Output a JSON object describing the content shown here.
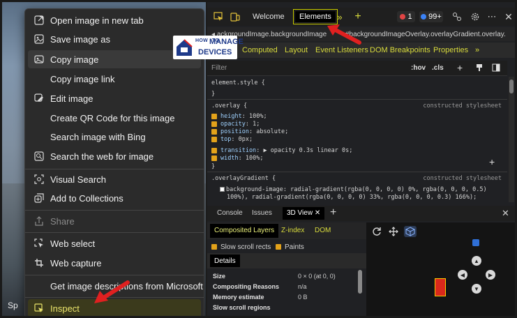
{
  "context_menu": {
    "items": [
      {
        "label": "Open image in new tab",
        "icon": "open-in-new-tab-icon"
      },
      {
        "label": "Save image as",
        "icon": "save-image-icon"
      },
      {
        "label": "Copy image",
        "icon": "copy-image-icon",
        "highlighted": true
      },
      {
        "label": "Copy image link",
        "icon": ""
      },
      {
        "label": "Edit image",
        "icon": "edit-image-icon"
      },
      {
        "label": "Create QR Code for this image",
        "icon": ""
      },
      {
        "label": "Search image with Bing",
        "icon": ""
      },
      {
        "label": "Search the web for image",
        "icon": "search-web-icon"
      },
      {
        "label": "Visual Search",
        "icon": "visual-search-icon"
      },
      {
        "label": "Add to Collections",
        "icon": "collections-icon"
      },
      {
        "label": "Share",
        "icon": "share-icon",
        "disabled": true
      },
      {
        "label": "Web select",
        "icon": "web-select-icon"
      },
      {
        "label": "Web capture",
        "icon": "web-capture-icon"
      },
      {
        "label": "Get image descriptions from Microsoft",
        "icon": ""
      },
      {
        "label": "Inspect",
        "icon": "inspect-icon"
      }
    ]
  },
  "taskbar_fragment": "Sp",
  "devtools": {
    "tabs": {
      "welcome": "Welcome",
      "elements": "Elements"
    },
    "badges": {
      "errors": "1",
      "info": "99+"
    },
    "breadcrumb": {
      "left": "ackgroundImage.backgroundImage",
      "right": "#backgroundImageOverlay.overlayGradient.overlay."
    },
    "subtabs": [
      "Computed",
      "Layout",
      "Event Listeners",
      "DOM Breakpoints",
      "Properties"
    ],
    "filter": {
      "placeholder": "Filter",
      "hov": ":hov",
      "cls": ".cls"
    },
    "styles": {
      "element_style": "element.style {",
      "close": "}",
      "overlay_selector": ".overlay {",
      "constructed": "constructed stylesheet",
      "overlay_props": [
        {
          "name": "height",
          "value": "100%;"
        },
        {
          "name": "opacity",
          "value": "1;"
        },
        {
          "name": "position",
          "value": "absolute;"
        },
        {
          "name": "top",
          "value": "0px;"
        },
        {
          "name": "transition",
          "value": "opacity 0.3s  linear 0s;"
        },
        {
          "name": "width",
          "value": "100%;"
        }
      ],
      "gradient_selector": ".overlayGradient {",
      "gradient_line1": "background-image: radial-gradient(rgba(0, 0, 0, 0) 0%, rgba(0, 0, 0, 0.5)",
      "gradient_line2": "100%), radial-gradient(rgba(0, 0, 0, 0) 33%, rgba(0, 0, 0, 0.3) 166%);"
    },
    "drawer": {
      "tabs": [
        "Console",
        "Issues",
        "3D View"
      ],
      "subtabs": [
        "Composited Layers",
        "Z-index",
        "DOM"
      ],
      "options": [
        "Slow scroll rects",
        "Paints"
      ],
      "details_tab": "Details",
      "details": [
        {
          "key": "Size",
          "value": "0 × 0 (at 0, 0)"
        },
        {
          "key": "Compositing Reasons",
          "value": "n/a"
        },
        {
          "key": "Memory estimate",
          "value": "0 B"
        },
        {
          "key": "Slow scroll regions",
          "value": ""
        }
      ]
    }
  },
  "watermark": {
    "line1": "HOW",
    "line1b": "TO",
    "line2": "MANAGE",
    "line3": "DEVICES"
  },
  "colors": {
    "accent_yellow": "#d8db3c",
    "arrow_red": "#e02020",
    "checkbox": "#e3a21a"
  }
}
